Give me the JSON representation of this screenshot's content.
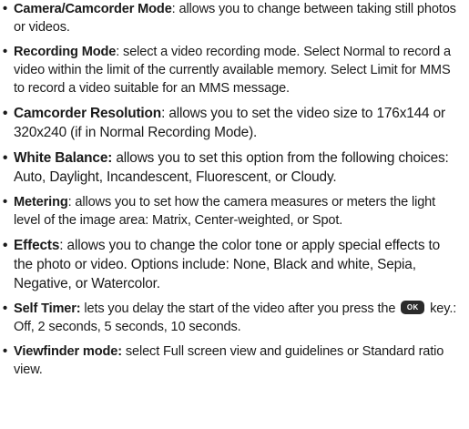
{
  "items": [
    {
      "term": "Camera/Camcorder Mode",
      "description": ": allows you to change between taking still photos or videos."
    },
    {
      "term": "Recording Mode",
      "description": ": select a video recording mode. Select Normal to record a video within the limit of the currently available memory. Select Limit for MMS to record a video suitable for an MMS message."
    },
    {
      "term": "Camcorder Resolution",
      "description": ": allows you to set the video size to 176x144 or 320x240 (if in Normal Recording Mode)."
    },
    {
      "term": "White Balance:",
      "description": " allows you to set this option from the following choices: Auto, Daylight, Incandescent, Fluorescent, or Cloudy."
    },
    {
      "term": "Metering",
      "description": ": allows you to set how the camera measures or meters the light level of the image area: Matrix, Center-weighted, or Spot."
    },
    {
      "term": "Effects",
      "description": ": allows you to change the color tone or apply special effects to the photo or video. Options include: None, Black and white, Sepia, Negative, or Watercolor."
    },
    {
      "term": "Self Timer:",
      "description_before_key": " lets you delay the start of the video after you press the ",
      "key_label": "OK",
      "description_after_key": " key.: Off, 2 seconds, 5 seconds, 10 seconds."
    },
    {
      "term": "Viewfinder mode:",
      "description": " select Full screen view and guidelines or Standard ratio view."
    }
  ]
}
